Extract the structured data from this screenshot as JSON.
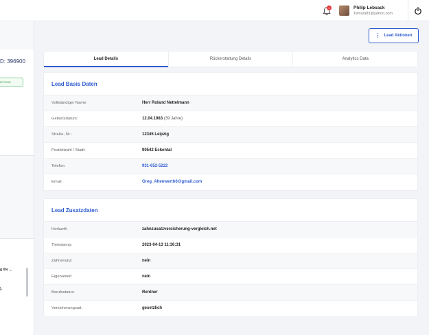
{
  "header": {
    "notifications_count": "1",
    "user_name": "Philip Lebsack",
    "user_email": "Tamara83@yahoo.com",
    "icons": [
      "bell-icon",
      "power-icon"
    ]
  },
  "left": {
    "lead_id_fragment": "D: 396900",
    "status_fragment": "BEITUNG",
    "note_fragment_1": "g the ...",
    "note_fragment_2": ")."
  },
  "actions": {
    "label": "Lead Aktionen"
  },
  "tabs": [
    {
      "label": "Lead Details",
      "active": true
    },
    {
      "label": "Rückerstattung Details",
      "active": false
    },
    {
      "label": "Analytics Data",
      "active": false
    }
  ],
  "basis": {
    "title": "Lead Basis Daten",
    "rows": [
      {
        "label": "Vollständiger Name:",
        "value": "Herr Roland Nettelmann"
      },
      {
        "label": "Geburtsdatum:",
        "value": "12.04.1983",
        "sub": " (39 Jahre)"
      },
      {
        "label": "Straße, Nr.:",
        "value": "12345 Leipzig"
      },
      {
        "label": "Postleitzahl / Stadt:",
        "value": "90542 Eckental"
      },
      {
        "label": "Telefon:",
        "value": "931-652-5222",
        "link": true
      },
      {
        "label": "Email:",
        "value": "Greg_Altenwerth6@gmail.com",
        "link": true
      }
    ]
  },
  "zusatz": {
    "title": "Lead Zusatzdaten",
    "rows": [
      {
        "label": "Herkunft:",
        "value": "zahnzusatzversicherung-vergleich.net"
      },
      {
        "label": "Timestamp:",
        "value": "2023-04-13 11:36:31"
      },
      {
        "label": "Zahnersatz:",
        "value": "nein"
      },
      {
        "label": "Eigenanteil:",
        "value": "nein"
      },
      {
        "label": "Berufsstatus:",
        "value": "Rentner"
      },
      {
        "label": "Versicherungsart:",
        "value": "gesetzlich"
      }
    ]
  }
}
